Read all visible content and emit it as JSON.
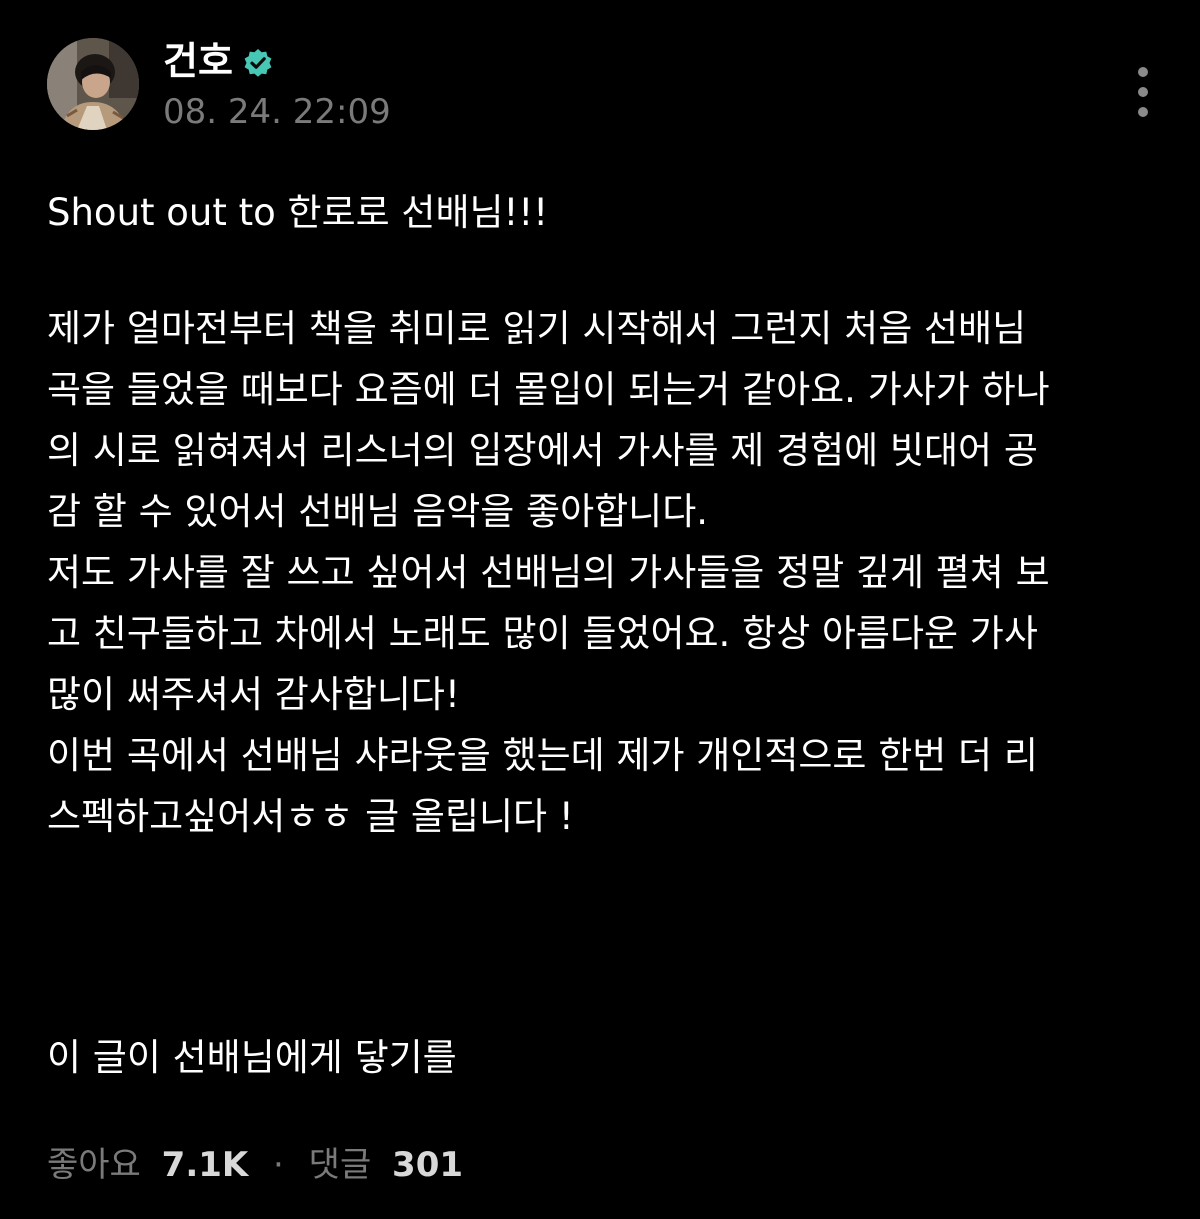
{
  "post": {
    "author": "건호",
    "verified": true,
    "timestamp": "08. 24. 22:09",
    "title_line": "Shout out to 한로로 선배님!!!",
    "body_lines": [
      "제가 얼마전부터 책을 취미로 읽기 시작해서 그런지 처음 선배님",
      "곡을 들었을 때보다 요즘에 더 몰입이 되는거 같아요. 가사가 하나",
      "의 시로 읽혀져서 리스너의 입장에서 가사를 제 경험에 빗대어 공",
      "감 할 수 있어서 선배님 음악을 좋아합니다.",
      "저도 가사를 잘 쓰고 싶어서 선배님의 가사들을 정말 깊게 펼쳐 보",
      "고 친구들하고 차에서 노래도 많이 들었어요. 항상 아름다운 가사",
      "많이 써주셔서 감사합니다!",
      "이번 곡에서 선배님 샤라웃을 했는데 제가 개인적으로 한번 더 리",
      "스펙하고싶어서ㅎㅎ 글 올립니다 !"
    ],
    "closing_line": "이 글이 선배님에게 닿기를"
  },
  "footer": {
    "likes_label": "좋아요",
    "likes_count": "7.1K",
    "separator": "·",
    "comments_label": "댓글",
    "comments_count": "301"
  },
  "icons": {
    "verified": "verified-badge-icon",
    "more": "more-vertical-icon"
  },
  "colors": {
    "background": "#000000",
    "text": "#ffffff",
    "muted": "#7a7a7a",
    "verified": "#46c8b4"
  }
}
